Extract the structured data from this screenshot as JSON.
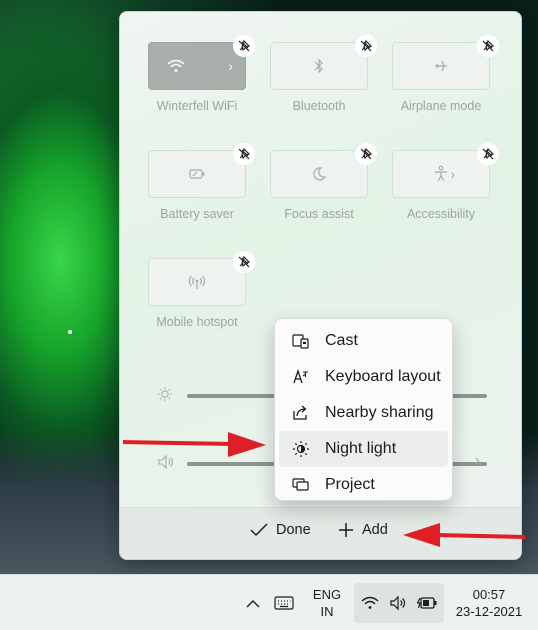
{
  "quick_settings": {
    "tiles": [
      {
        "label": "Winterfell WiFi",
        "icon": "wifi-icon",
        "active": true,
        "has_chevron": true
      },
      {
        "label": "Bluetooth",
        "icon": "bluetooth-icon",
        "active": false,
        "has_chevron": false
      },
      {
        "label": "Airplane mode",
        "icon": "airplane-icon",
        "active": false,
        "has_chevron": false
      },
      {
        "label": "Battery saver",
        "icon": "battery-saver-icon",
        "active": false,
        "has_chevron": false
      },
      {
        "label": "Focus assist",
        "icon": "moon-icon",
        "active": false,
        "has_chevron": false
      },
      {
        "label": "Accessibility",
        "icon": "accessibility-icon",
        "active": false,
        "has_chevron": true
      },
      {
        "label": "Mobile hotspot",
        "icon": "hotspot-icon",
        "active": false,
        "has_chevron": false
      }
    ],
    "unpin_icon": "unpin-icon",
    "brightness_icon": "brightness-icon",
    "volume_icon": "volume-icon",
    "done_label": "Done",
    "add_label": "Add"
  },
  "add_menu": {
    "items": [
      {
        "label": "Cast",
        "icon": "cast-icon"
      },
      {
        "label": "Keyboard layout",
        "icon": "keyboard-layout-icon"
      },
      {
        "label": "Nearby sharing",
        "icon": "nearby-sharing-icon"
      },
      {
        "label": "Night light",
        "icon": "night-light-icon",
        "highlighted": true
      },
      {
        "label": "Project",
        "icon": "project-icon"
      }
    ]
  },
  "taskbar": {
    "language_line1": "ENG",
    "language_line2": "IN",
    "time": "00:57",
    "date": "23-12-2021"
  },
  "colors": {
    "annotation_arrow": "#e01e26",
    "panel_bg": "#e3f3e6",
    "tile_active": "#a8aeaa"
  }
}
